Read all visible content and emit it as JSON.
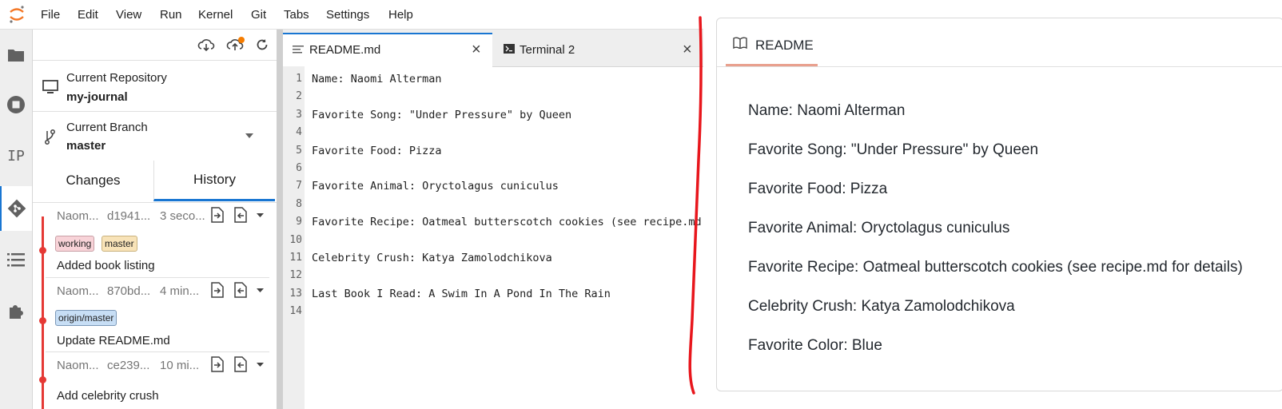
{
  "menu": [
    "File",
    "Edit",
    "View",
    "Run",
    "Kernel",
    "Git",
    "Tabs",
    "Settings",
    "Help"
  ],
  "activity_icons": [
    "folder-icon",
    "stop-circle-icon",
    "ip-icon",
    "git-icon",
    "list-icon",
    "puzzle-icon"
  ],
  "activity_ip_text": "IP",
  "git": {
    "current_repository_label": "Current Repository",
    "current_repository": "my-journal",
    "current_branch_label": "Current Branch",
    "current_branch": "master",
    "tabs": [
      "Changes",
      "History"
    ],
    "commits": [
      {
        "author": "Naom...",
        "hash": "d1941...",
        "time": "3 seco...",
        "tags": [
          {
            "text": "working",
            "color": "#f8d3d8",
            "border": "#c8a0a6"
          },
          {
            "text": "master",
            "color": "#f8e3b8",
            "border": "#c9b27d"
          }
        ],
        "message": "Added book listing"
      },
      {
        "author": "Naom...",
        "hash": "870bd...",
        "time": "4 min...",
        "tags": [
          {
            "text": "origin/master",
            "color": "#c7def5",
            "border": "#7b98b8"
          }
        ],
        "message": "Update README.md"
      },
      {
        "author": "Naom...",
        "hash": "ce239...",
        "time": "10 mi...",
        "tags": [],
        "message": "Add celebrity crush"
      }
    ]
  },
  "editor": {
    "tabs": [
      {
        "label": "README.md",
        "active": true
      },
      {
        "label": "Terminal 2",
        "active": false
      }
    ],
    "lines": [
      "Name: Naomi Alterman",
      "",
      "Favorite Song: \"Under Pressure\" by Queen",
      "",
      "Favorite Food: Pizza",
      "",
      "Favorite Animal: Oryctolagus cuniculus",
      "",
      "Favorite Recipe: Oatmeal butterscotch cookies (see recipe.md for details)",
      "",
      "Celebrity Crush: Katya Zamolodchikova",
      "",
      "Last Book I Read: A Swim In A Pond In The Rain",
      ""
    ]
  },
  "preview": {
    "title": "README",
    "items": [
      "Name: Naomi Alterman",
      "Favorite Song: \"Under Pressure\" by Queen",
      "Favorite Food: Pizza",
      "Favorite Animal: Oryctolagus cuniculus",
      "Favorite Recipe: Oatmeal butterscotch cookies (see recipe.md for details)",
      "Celebrity Crush: Katya Zamolodchikova",
      "Favorite Color: Blue"
    ]
  },
  "colors": {
    "accent": "#1976d2",
    "timeline": "#e53935",
    "annotation": "#e8161c",
    "preview_underline": "#e9a08e"
  }
}
